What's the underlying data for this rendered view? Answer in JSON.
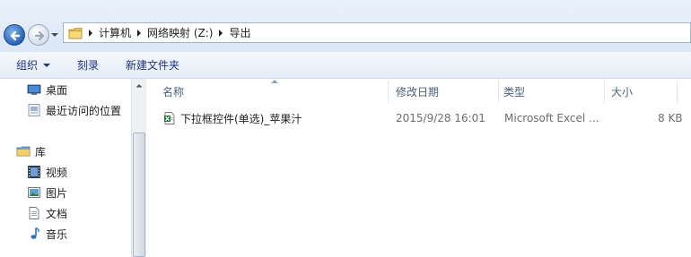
{
  "address_bar": {
    "crumbs": [
      "计算机",
      "网络映射 (Z:)",
      "导出"
    ]
  },
  "toolbar": {
    "organize_label": "组织",
    "burn_label": "刻录",
    "new_folder_label": "新建文件夹"
  },
  "nav_pane": {
    "favorites": [
      {
        "label": "桌面",
        "icon": "desktop-icon"
      },
      {
        "label": "最近访问的位置",
        "icon": "recent-places-icon"
      }
    ],
    "libraries": {
      "label": "库",
      "icon": "libraries-icon",
      "items": [
        {
          "label": "视频",
          "icon": "video-icon"
        },
        {
          "label": "图片",
          "icon": "pictures-icon"
        },
        {
          "label": "文档",
          "icon": "documents-icon"
        },
        {
          "label": "音乐",
          "icon": "music-icon"
        }
      ]
    }
  },
  "file_list": {
    "columns": {
      "name": "名称",
      "modified": "修改日期",
      "type": "类型",
      "size": "大小"
    },
    "rows": [
      {
        "name": "下拉框控件(单选)_苹果汁",
        "modified": "2015/9/28 16:01",
        "type": "Microsoft Excel ...",
        "size": "8 KB",
        "icon": "excel-file-icon"
      }
    ]
  },
  "colors": {
    "toolbar_text": "#1e3287",
    "header_text": "#4c607a",
    "meta_text": "#6d6d6d",
    "excel_green": "#1f7a3c"
  }
}
